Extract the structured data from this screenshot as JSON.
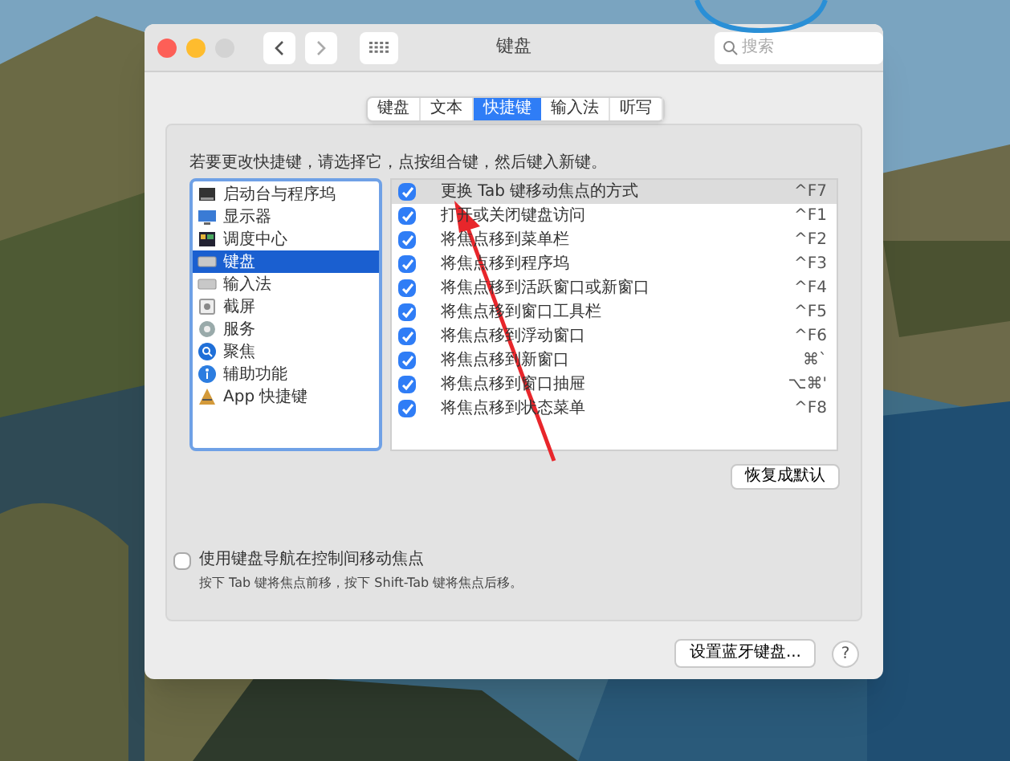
{
  "window": {
    "title": "键盘",
    "search": {
      "placeholder": "搜索"
    }
  },
  "tabs": [
    {
      "label": "键盘",
      "selected": false
    },
    {
      "label": "文本",
      "selected": false
    },
    {
      "label": "快捷键",
      "selected": true
    },
    {
      "label": "输入法",
      "selected": false
    },
    {
      "label": "听写",
      "selected": false
    }
  ],
  "instruction": "若要更改快捷键，请选择它，点按组合键，然后键入新键。",
  "categories": [
    {
      "label": "启动台与程序坞",
      "kind": "dock",
      "selected": false
    },
    {
      "label": "显示器",
      "kind": "display",
      "selected": false
    },
    {
      "label": "调度中心",
      "kind": "mission",
      "selected": false
    },
    {
      "label": "键盘",
      "kind": "keyboard",
      "selected": true
    },
    {
      "label": "输入法",
      "kind": "keyboard",
      "selected": false
    },
    {
      "label": "截屏",
      "kind": "camera",
      "selected": false
    },
    {
      "label": "服务",
      "kind": "gear",
      "selected": false
    },
    {
      "label": "聚焦",
      "kind": "search",
      "selected": false
    },
    {
      "label": "辅助功能",
      "kind": "access",
      "selected": false
    },
    {
      "label": "App 快捷键",
      "kind": "app",
      "selected": false
    }
  ],
  "shortcuts": [
    {
      "label": "更换 Tab 键移动焦点的方式",
      "key": "^F7",
      "checked": true,
      "selected": true
    },
    {
      "label": "打开或关闭键盘访问",
      "key": "^F1",
      "checked": true,
      "selected": false
    },
    {
      "label": "将焦点移到菜单栏",
      "key": "^F2",
      "checked": true,
      "selected": false
    },
    {
      "label": "将焦点移到程序坞",
      "key": "^F3",
      "checked": true,
      "selected": false
    },
    {
      "label": "将焦点移到活跃窗口或新窗口",
      "key": "^F4",
      "checked": true,
      "selected": false
    },
    {
      "label": "将焦点移到窗口工具栏",
      "key": "^F5",
      "checked": true,
      "selected": false
    },
    {
      "label": "将焦点移到浮动窗口",
      "key": "^F6",
      "checked": true,
      "selected": false
    },
    {
      "label": "将焦点移到新窗口",
      "key": "⌘`",
      "checked": true,
      "selected": false
    },
    {
      "label": "将焦点移到窗口抽屉",
      "key": "⌥⌘'",
      "checked": true,
      "selected": false
    },
    {
      "label": "将焦点移到状态菜单",
      "key": "^F8",
      "checked": true,
      "selected": false
    }
  ],
  "restore_button": "恢复成默认",
  "keyboard_navigation": {
    "label": "使用键盘导航在控制间移动焦点",
    "checked": false,
    "hint": "按下 Tab 键将焦点前移，按下 Shift-Tab 键将焦点后移。"
  },
  "bluetooth_button": "设置蓝牙键盘...",
  "help_button": "?"
}
